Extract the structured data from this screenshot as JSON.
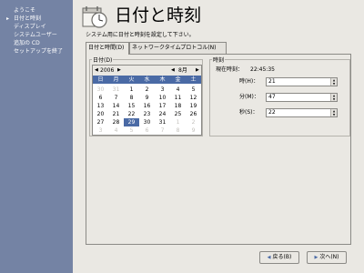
{
  "sidebar": {
    "steps": [
      {
        "label": "ようこそ"
      },
      {
        "label": "日付と時刻"
      },
      {
        "label": "ディスプレイ"
      },
      {
        "label": "システムユーザー"
      },
      {
        "label": "追加の CD"
      },
      {
        "label": "セットアップを終了"
      }
    ],
    "current_marker": "▸"
  },
  "header": {
    "title": "日付と時刻",
    "icon": "calendar-clock-icon"
  },
  "instruction": "システム用に日付と時刻を設定して下さい。",
  "tabs": [
    {
      "label": "日付と時間(D)"
    },
    {
      "label": "ネットワークタイムプロトコル(N)"
    }
  ],
  "calendar": {
    "group_label": "日付(D)",
    "year": "2006",
    "month": "8月",
    "weekdays": [
      "日",
      "月",
      "火",
      "水",
      "木",
      "金",
      "土"
    ],
    "weeks": [
      [
        "30",
        "31",
        "1",
        "2",
        "3",
        "4",
        "5"
      ],
      [
        "6",
        "7",
        "8",
        "9",
        "10",
        "11",
        "12"
      ],
      [
        "13",
        "14",
        "15",
        "16",
        "17",
        "18",
        "19"
      ],
      [
        "20",
        "21",
        "22",
        "23",
        "24",
        "25",
        "26"
      ],
      [
        "27",
        "28",
        "29",
        "30",
        "31",
        "1",
        "2"
      ],
      [
        "3",
        "4",
        "5",
        "6",
        "7",
        "8",
        "9"
      ]
    ],
    "selected_day": "29",
    "accent_color": "#4a6aa5"
  },
  "time": {
    "group_label": "時刻",
    "current_label": "現在時刻：",
    "current_value": "22:45:35",
    "hour_label": "時(H)：",
    "hour_value": "21",
    "minute_label": "分(M)：",
    "minute_value": "47",
    "second_label": "秒(S)：",
    "second_value": "22"
  },
  "buttons": {
    "back_label": "戻る(B)",
    "next_label": "次へ(N)"
  }
}
